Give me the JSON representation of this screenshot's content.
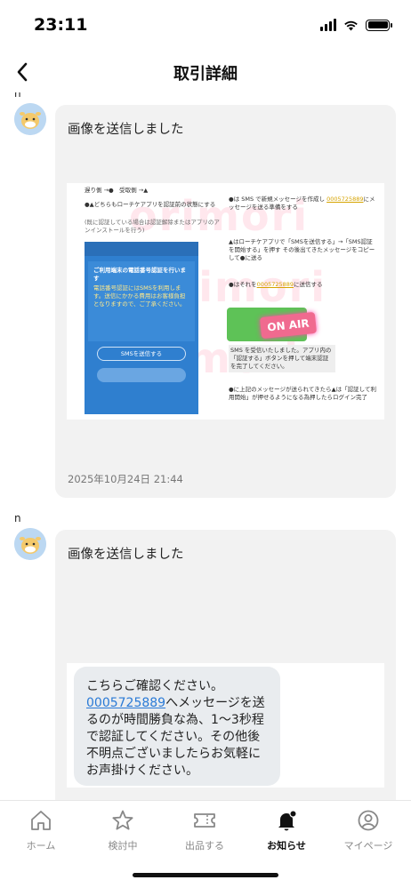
{
  "status_bar": {
    "time": "23:11"
  },
  "header": {
    "title": "取引詳細"
  },
  "messages": [
    {
      "sender": "n",
      "text": "画像を送信しました",
      "timestamp": "2025年10月24日 21:44",
      "image": {
        "top_left_label": "遅り側 →●　受取側 →▲",
        "left_note": "●▲どちらもローチケアプリを認証前の状態にする",
        "left_note_sub": "(既に認証している場合は認証解除またはアプリのアンインストールを行う)",
        "right_step1": "●は SMS で新規メッセージを作成し",
        "right_step1_link": "0005725889",
        "right_step1_tail": "にメッセージを送る準備をする",
        "right_step2": "▲はローチケアプリで「SMSを送信する」→「SMS認証を開始する」を押す",
        "right_step2_tail": "その後出てきたメッセージをコピーして●に送る",
        "right_step3": "●はそれを",
        "right_step3_link": "0005725889",
        "right_step3_tail": "に送信する",
        "phone_heading": "ご利用端末の電話番号認証を行います",
        "phone_body": "電話番号認証にはSMSを利用します。送信にかかる費用はお客様負担となりますので、ご了承ください。",
        "phone_button": "SMSを送信する",
        "onair": "ON AIR",
        "sms_done": "SMS を受信いたしました。アプリ内の「認証する」ボタンを押して端末認証を完了してください。",
        "bottom_note": "●に上記のメッセージが送られてきたら▲は「認証して利用開始」が押せるようになる為押したらログイン完了",
        "watermark": "orimori"
      }
    },
    {
      "sender": "n",
      "text": "画像を送信しました",
      "image": {
        "line1": "こちらご確認ください。",
        "link": "0005725889",
        "rest": "へメッセージを送るのが時間勝負な為、1〜3秒程で認証してください。その他後不明点ございましたらお気軽にお声掛けください。"
      }
    }
  ],
  "tabbar": {
    "items": [
      {
        "label": "ホーム",
        "icon": "home-icon"
      },
      {
        "label": "検討中",
        "icon": "star-icon"
      },
      {
        "label": "出品する",
        "icon": "ticket-icon"
      },
      {
        "label": "お知らせ",
        "icon": "bell-icon",
        "active": true
      },
      {
        "label": "マイページ",
        "icon": "user-icon"
      }
    ]
  }
}
